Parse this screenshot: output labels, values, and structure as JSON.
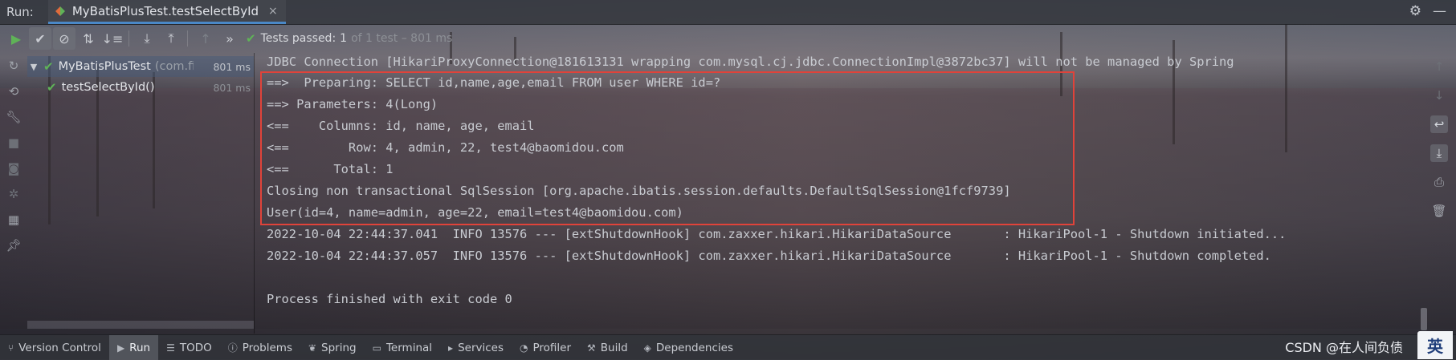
{
  "topbar": {
    "run_label": "Run:",
    "tab_title": "MyBatisPlusTest.testSelectById",
    "tab_close": "×",
    "gear_icon": "gear-icon",
    "minimize_icon": "minus-icon"
  },
  "toolbar": {
    "tests_passed_label": "Tests passed:",
    "tests_passed_count": "1",
    "tests_passed_detail": "of 1 test – 801 ms",
    "more_symbol": "»"
  },
  "tree": {
    "items": [
      {
        "name": "MyBatisPlusTest",
        "package": "(com.fi",
        "time": "801 ms",
        "expanded": true
      },
      {
        "name": "testSelectById()",
        "time": "801 ms"
      }
    ]
  },
  "console": {
    "lines": [
      "JDBC Connection [HikariProxyConnection@181613131 wrapping com.mysql.cj.jdbc.ConnectionImpl@3872bc37] will not be managed by Spring",
      "==>  Preparing: SELECT id,name,age,email FROM user WHERE id=?",
      "==> Parameters: 4(Long)",
      "<==    Columns: id, name, age, email",
      "<==        Row: 4, admin, 22, test4@baomidou.com",
      "<==      Total: 1",
      "Closing non transactional SqlSession [org.apache.ibatis.session.defaults.DefaultSqlSession@1fcf9739]",
      "User(id=4, name=admin, age=22, email=test4@baomidou.com)",
      "2022-10-04 22:44:37.041  INFO 13576 --- [extShutdownHook] com.zaxxer.hikari.HikariDataSource       : HikariPool-1 - Shutdown initiated...",
      "2022-10-04 22:44:37.057  INFO 13576 --- [extShutdownHook] com.zaxxer.hikari.HikariDataSource       : HikariPool-1 - Shutdown completed.",
      "",
      "Process finished with exit code 0"
    ]
  },
  "bottombar": {
    "items": [
      {
        "label": "Version Control",
        "icon": "branch-icon"
      },
      {
        "label": "Run",
        "icon": "play-icon",
        "active": true
      },
      {
        "label": "TODO",
        "icon": "list-icon"
      },
      {
        "label": "Problems",
        "icon": "info-icon"
      },
      {
        "label": "Spring",
        "icon": "leaf-icon"
      },
      {
        "label": "Terminal",
        "icon": "terminal-icon"
      },
      {
        "label": "Services",
        "icon": "services-icon"
      },
      {
        "label": "Profiler",
        "icon": "profiler-icon"
      },
      {
        "label": "Build",
        "icon": "hammer-icon"
      },
      {
        "label": "Dependencies",
        "icon": "layers-icon"
      }
    ],
    "watermark": "CSDN @在人间负债"
  },
  "colors": {
    "pass_green": "#5fb357",
    "highlight_red": "#e0433a",
    "tab_underline": "#4a88c7"
  }
}
